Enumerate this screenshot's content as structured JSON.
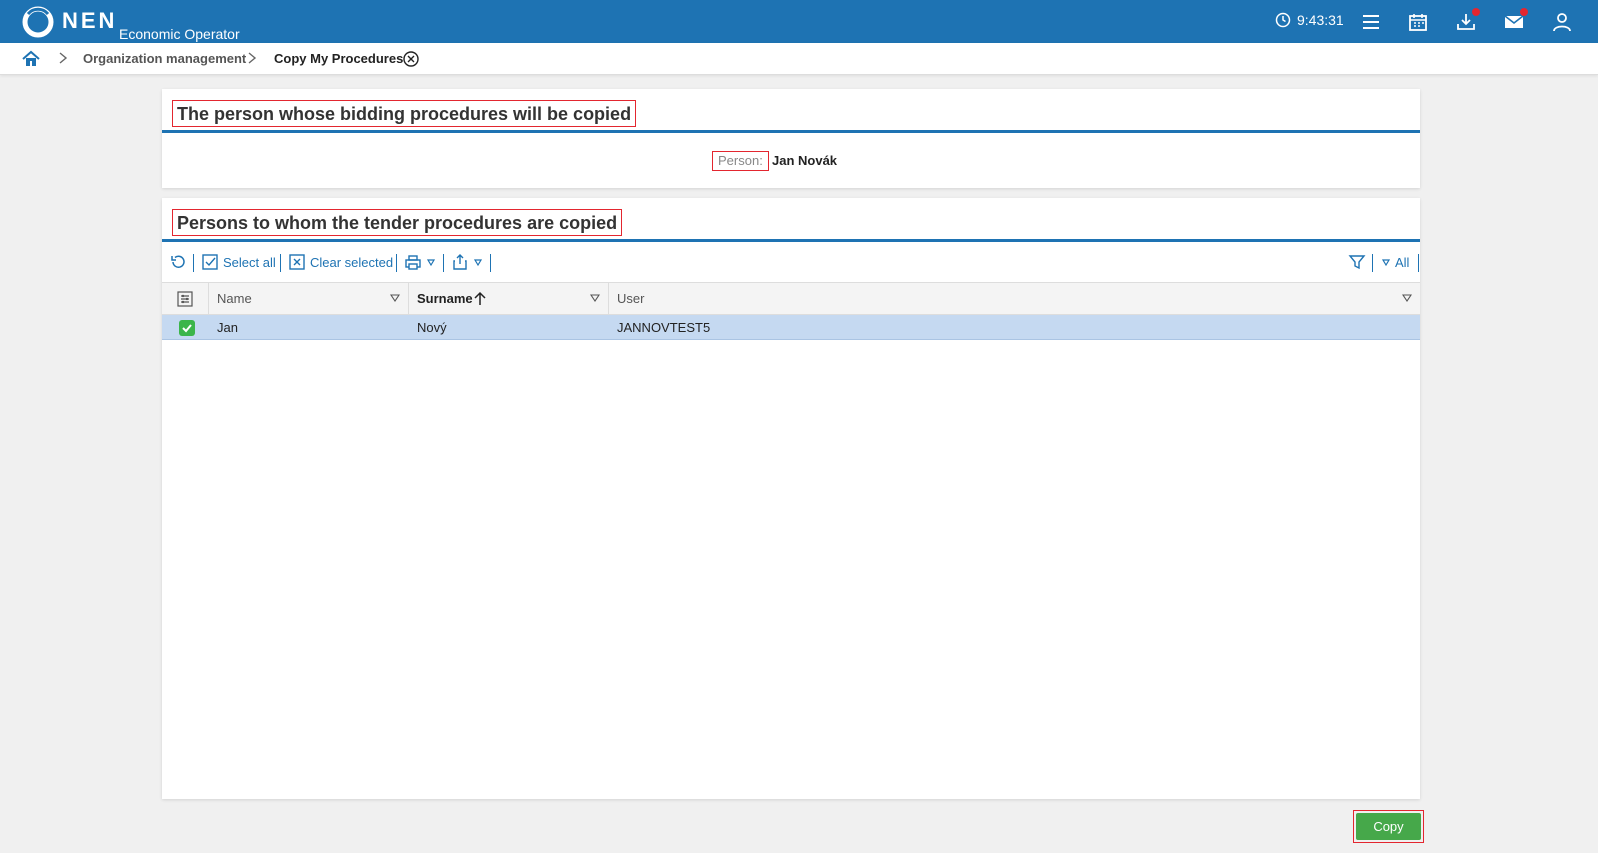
{
  "header": {
    "brand": "NEN",
    "subtitle": "Economic Operator",
    "time": "9:43:31",
    "colors": {
      "bar": "#1e73b3",
      "badge": "#e3262f"
    },
    "icons": [
      "clock-icon",
      "menu-icon",
      "calendar-icon",
      "download-icon",
      "mail-icon",
      "user-icon"
    ]
  },
  "breadcrumb": {
    "items": [
      "Organization management",
      "Copy My Procedures"
    ]
  },
  "source_panel": {
    "title": "The person whose bidding procedures will be copied",
    "person_label": "Person:",
    "person_value": "Jan Novák"
  },
  "target_panel": {
    "title": "Persons to whom the tender procedures are copied",
    "toolbar": {
      "select_all": "Select all",
      "clear_selected": "Clear selected",
      "filter_all": "All"
    },
    "columns": [
      "Name",
      "Surname",
      "User"
    ],
    "sorted_column": "Surname",
    "rows": [
      {
        "name": "Jan",
        "surname": "Nový",
        "user": "JANNOVTEST5",
        "selected": true
      }
    ]
  },
  "actions": {
    "copy": "Copy",
    "copy_color": "#46a84a"
  }
}
